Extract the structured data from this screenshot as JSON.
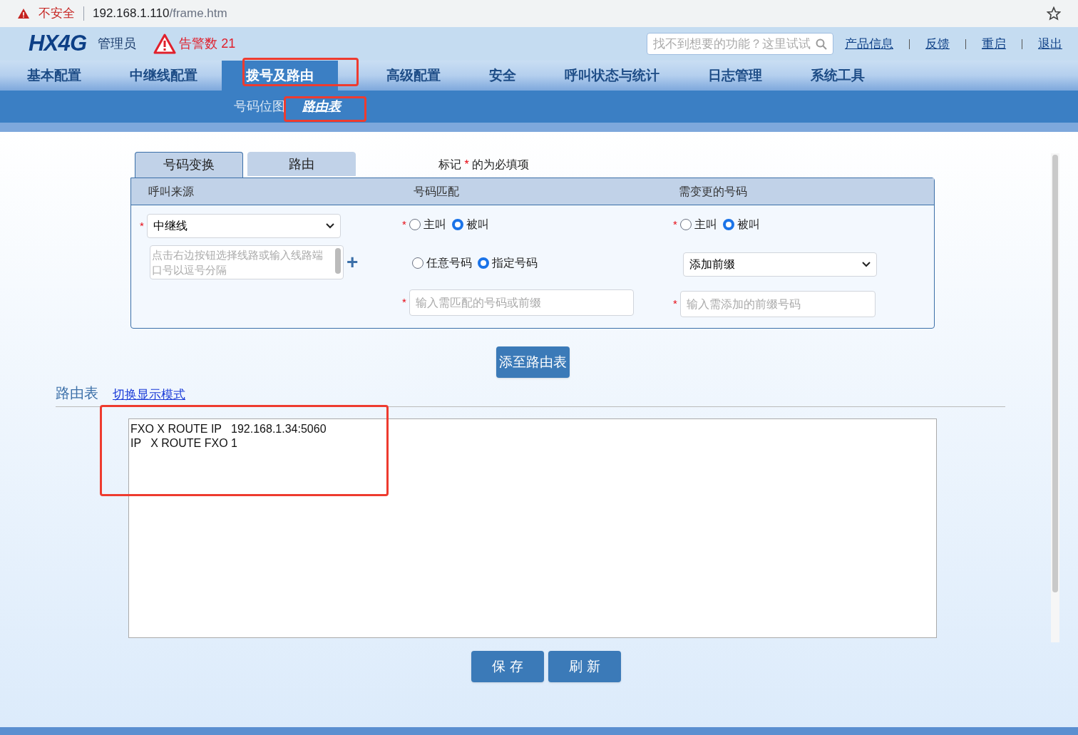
{
  "browser": {
    "security_label": "不安全",
    "url_host": "192.168.1.110",
    "url_path": "/frame.htm"
  },
  "header": {
    "logo": "HX4G",
    "user": "管理员",
    "alarm": "告警数 21",
    "search": {
      "placeholder": "找不到想要的功能？这里试试"
    },
    "links": [
      "产品信息",
      "反馈",
      "重启",
      "退出"
    ]
  },
  "nav": [
    {
      "label": "基本配置",
      "selected": false
    },
    {
      "label": "中继线配置",
      "selected": false
    },
    {
      "label": "拨号及路由",
      "selected": true
    },
    {
      "label": "高级配置",
      "selected": false
    },
    {
      "label": "安全",
      "selected": false
    },
    {
      "label": "呼叫状态与统计",
      "selected": false
    },
    {
      "label": "日志管理",
      "selected": false
    },
    {
      "label": "系统工具",
      "selected": false
    }
  ],
  "subnav": [
    {
      "label": "号码位图",
      "selected": false
    },
    {
      "label": "路由表",
      "selected": true
    }
  ],
  "tabs": [
    {
      "label": "号码变换",
      "selected": true
    },
    {
      "label": "路由",
      "selected": false
    }
  ],
  "required_note": {
    "before": "标记",
    "mark": "*",
    "after": "的为必填项"
  },
  "columns": [
    "呼叫来源",
    "号码匹配",
    "需变更的号码"
  ],
  "source": {
    "select": "中继线",
    "ports_placeholder": "点击右边按钮选择线路或输入线路端口号以逗号分隔",
    "add": "+"
  },
  "match": {
    "direction": [
      {
        "label": "主叫",
        "selected": false
      },
      {
        "label": "被叫",
        "selected": true
      }
    ],
    "mode": [
      {
        "label": "任意号码",
        "selected": false
      },
      {
        "label": "指定号码",
        "selected": true
      }
    ],
    "number_placeholder": "输入需匹配的号码或前缀"
  },
  "change": {
    "direction": [
      {
        "label": "主叫",
        "selected": false
      },
      {
        "label": "被叫",
        "selected": true
      }
    ],
    "select": "添加前缀",
    "prefix_placeholder": "输入需添加的前缀号码"
  },
  "add_button": "添至路由表",
  "route_table": {
    "title": "路由表",
    "toggle_link": "切换显示模式",
    "lines": [
      "FXO X ROUTE IP   192.168.1.34:5060",
      "IP   X ROUTE FXO 1"
    ]
  },
  "buttons": [
    "保 存",
    "刷 新"
  ]
}
